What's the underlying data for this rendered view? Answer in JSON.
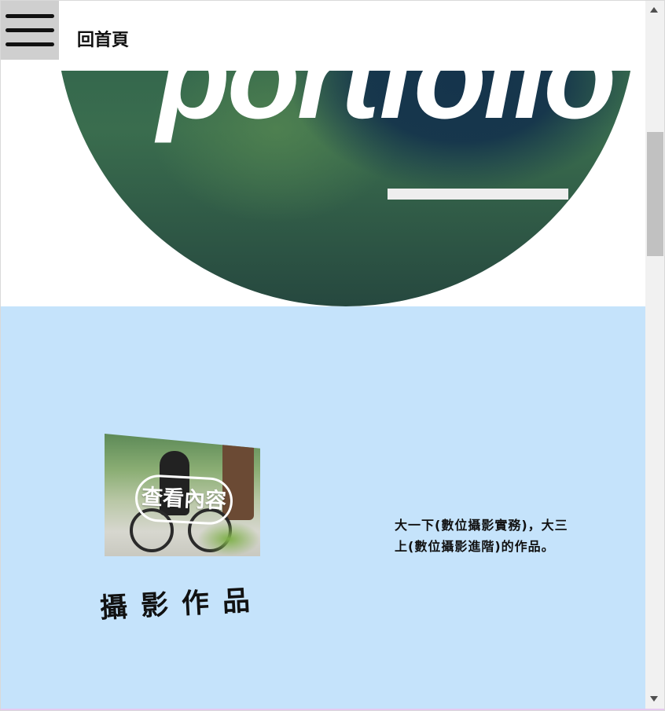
{
  "header": {
    "home_label": "回首頁",
    "menu_icon": "hamburger-icon"
  },
  "hero": {
    "word": "portfolio"
  },
  "work": {
    "view_button": "查看內容",
    "title": "攝影作品",
    "description": "大一下(數位攝影實務)，大三上(數位攝影進階)的作品。"
  },
  "colors": {
    "section_bg": "#c5e3fb",
    "menu_bg": "#cfcfcf",
    "text": "#111111"
  }
}
